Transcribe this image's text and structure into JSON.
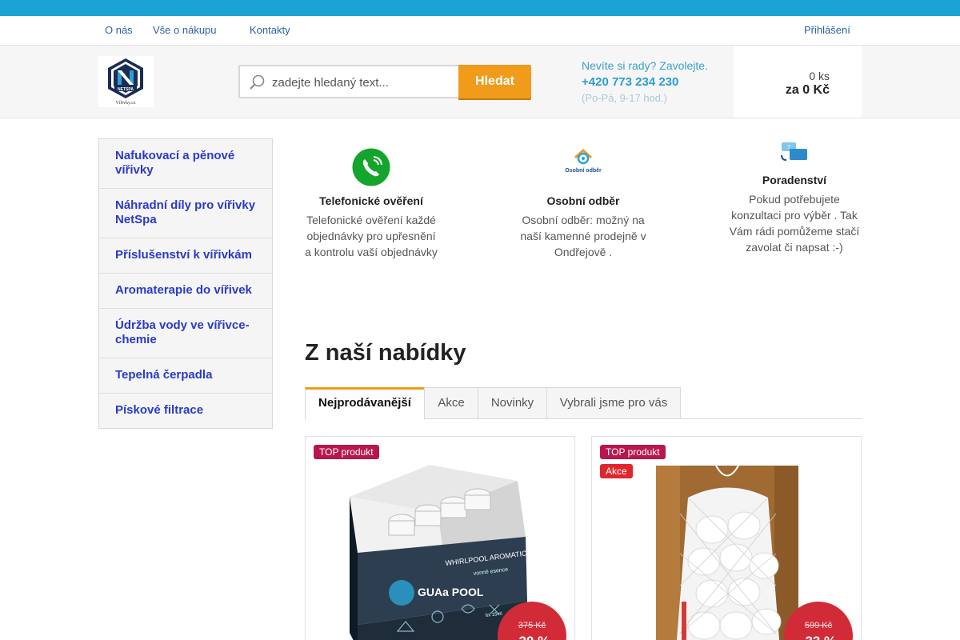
{
  "topbar": {
    "icon": ""
  },
  "nav": {
    "items": [
      {
        "label": "O nás"
      },
      {
        "label": "Vše o nákupu",
        "chevron": ""
      },
      {
        "label": "Kontakty"
      }
    ],
    "login_label": "Přihlášení",
    "login_icon": ""
  },
  "header": {
    "logo_text": "NETSPA",
    "logo_sub": "Vířivky.cz",
    "search_placeholder": "zadejte hledaný text...",
    "search_button": "Hledat",
    "contact_help": "Nevíte si rady? Zavolejte.",
    "contact_phone": "+420 773 234 230",
    "contact_hours": "(Po-Pá, 9-17 hod.)",
    "phone_icon": "",
    "cart_icon": "",
    "cart_qty": "0 ks",
    "cart_total": "za 0 Kč"
  },
  "sidebar": {
    "items": [
      {
        "label": "Nafukovací a pěnové vířivky",
        "arrow": ""
      },
      {
        "label": "Náhradní díly pro vířivky NetSpa"
      },
      {
        "label": "Příslušenství k vířivkám"
      },
      {
        "label": "Aromaterapie do vířivek"
      },
      {
        "label": "Údržba vody ve vířivce- chemie"
      },
      {
        "label": "Tepelná čerpadla"
      },
      {
        "label": "Pískové filtrace"
      }
    ]
  },
  "benefits": [
    {
      "icon": "phone-verify-icon",
      "title": "Telefonické ověření",
      "text": "Telefonické ověření každé objednávky pro upřesnění a kontrolu vaší objednávky"
    },
    {
      "icon": "personal-pickup-icon",
      "title": "Osobní odběr",
      "text": "Osobní odběr: možný na naší kamenné prodejně v Ondřejově .",
      "icon_label": "Osobní odběr"
    },
    {
      "icon": "advice-chat-icon",
      "title": "Poradenství",
      "text": "Pokud potřebujete konzultaci pro výběr . Tak Vám rádi pomůžeme stačí zavolat či napsat :-)"
    }
  ],
  "section_title": "Z naší nabídky",
  "tabs": [
    {
      "label": "Nejprodávanější",
      "active": true
    },
    {
      "label": "Akce"
    },
    {
      "label": "Novinky"
    },
    {
      "label": "Vybrali jsme pro vás"
    }
  ],
  "products": [
    {
      "flags": [
        "TOP produkt"
      ],
      "old_price": "375 Kč",
      "discount": "-20 %",
      "box_brand": "GUAa POOL",
      "box_label": "WHIRLPOOL AROMATIC",
      "box_sub": "vonné esence",
      "box_volume": "6x 15ml"
    },
    {
      "flags": [
        "TOP produkt",
        "Akce"
      ],
      "old_price": "599 Kč",
      "discount": "-33 %"
    }
  ],
  "colors": {
    "topbar": "#1aa3d3",
    "accent": "#f19b1b",
    "link": "#2a3ac9",
    "cart": "#1ec83c",
    "discount": "#d12b38"
  }
}
